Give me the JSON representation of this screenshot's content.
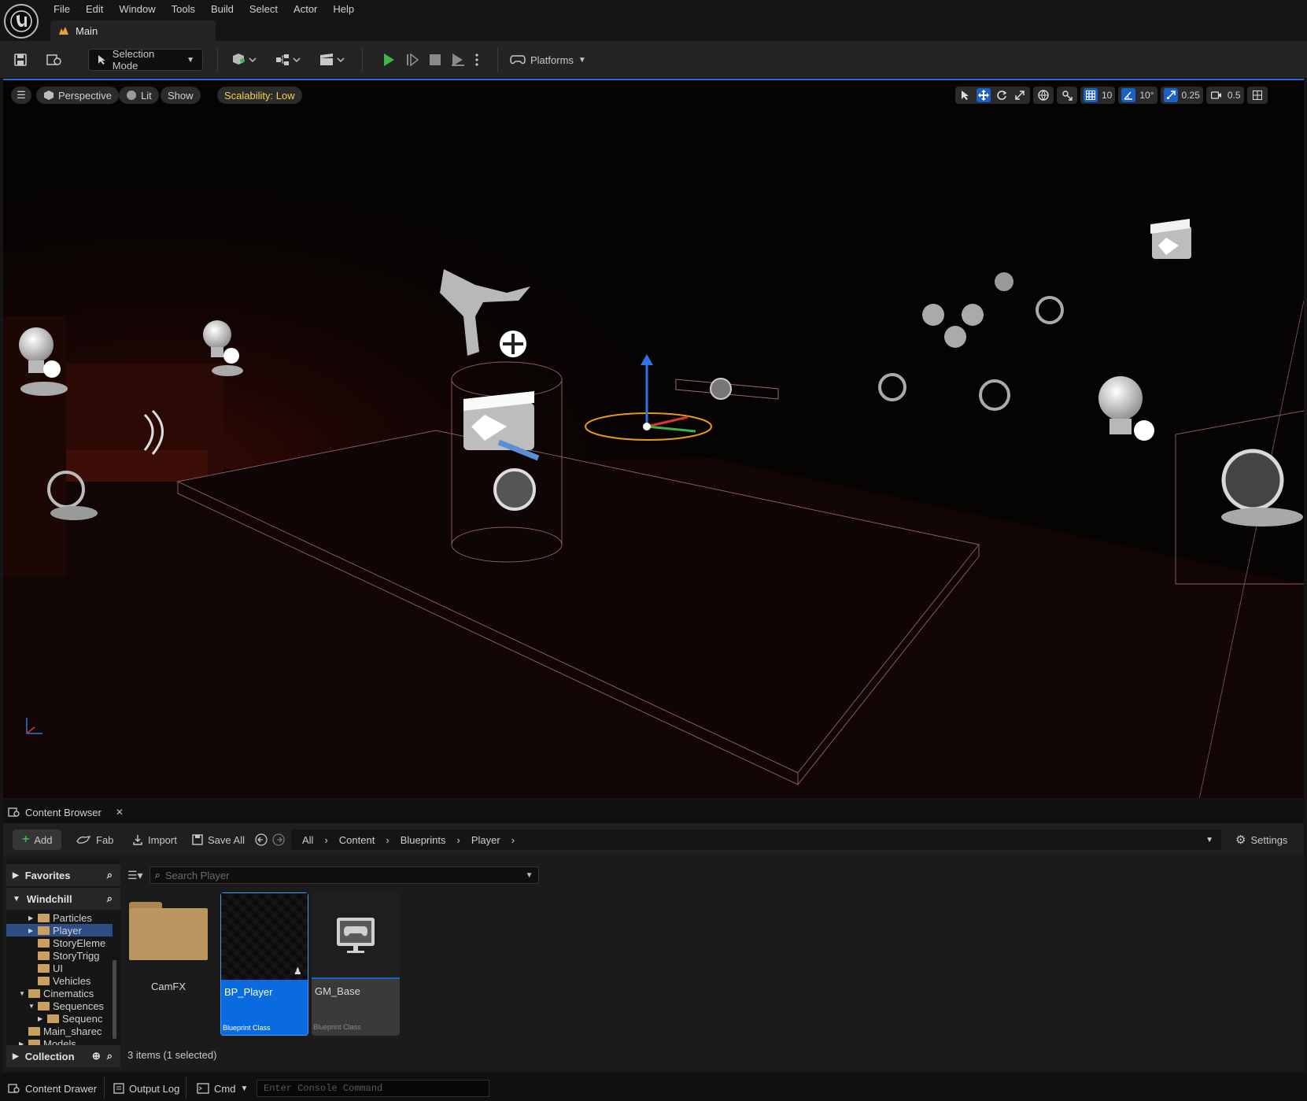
{
  "menu": {
    "items": [
      "File",
      "Edit",
      "Window",
      "Tools",
      "Build",
      "Select",
      "Actor",
      "Help"
    ]
  },
  "level_tab": {
    "label": "Main"
  },
  "toolbar": {
    "selection_mode": "Selection Mode",
    "platforms": "Platforms"
  },
  "viewport": {
    "perspective": "Perspective",
    "lit": "Lit",
    "show": "Show",
    "scalability": "Scalability: Low",
    "grid_snap": "10",
    "rotation_snap": "10°",
    "scale_snap": "0.25",
    "camera_speed": "0.5",
    "accent_color": "#1a60c7",
    "scalability_color": "#f0d24a"
  },
  "content_browser": {
    "tab_label": "Content Browser",
    "add": "Add",
    "fab": "Fab",
    "import": "Import",
    "save_all": "Save All",
    "breadcrumb": [
      "All",
      "Content",
      "Blueprints",
      "Player"
    ],
    "settings": "Settings",
    "favorites": "Favorites",
    "project": "Windchill",
    "collection": "Collection",
    "tree": [
      {
        "label": "Particles",
        "depth": 2,
        "arrow": "right",
        "selected": false
      },
      {
        "label": "Player",
        "depth": 2,
        "arrow": "right",
        "selected": true
      },
      {
        "label": "StoryEleme",
        "depth": 2,
        "arrow": "",
        "selected": false
      },
      {
        "label": "StoryTrigg",
        "depth": 2,
        "arrow": "",
        "selected": false
      },
      {
        "label": "UI",
        "depth": 2,
        "arrow": "",
        "selected": false
      },
      {
        "label": "Vehicles",
        "depth": 2,
        "arrow": "",
        "selected": false
      },
      {
        "label": "Cinematics",
        "depth": 1,
        "arrow": "down",
        "selected": false
      },
      {
        "label": "Sequences",
        "depth": 2,
        "arrow": "down",
        "selected": false
      },
      {
        "label": "Sequenc",
        "depth": 3,
        "arrow": "right",
        "selected": false
      },
      {
        "label": "Main_sharec",
        "depth": 1,
        "arrow": "",
        "selected": false
      },
      {
        "label": "Models",
        "depth": 1,
        "arrow": "right",
        "selected": false
      }
    ],
    "search_placeholder": "Search Player",
    "assets": [
      {
        "name": "CamFX",
        "type": ""
      },
      {
        "name": "BP_Player",
        "type": "Blueprint Class"
      },
      {
        "name": "GM_Base",
        "type": "Blueprint Class"
      }
    ],
    "status": "3 items (1 selected)"
  },
  "statusbar": {
    "content_drawer": "Content Drawer",
    "output_log": "Output Log",
    "cmd": "Cmd",
    "console_placeholder": "Enter Console Command"
  }
}
